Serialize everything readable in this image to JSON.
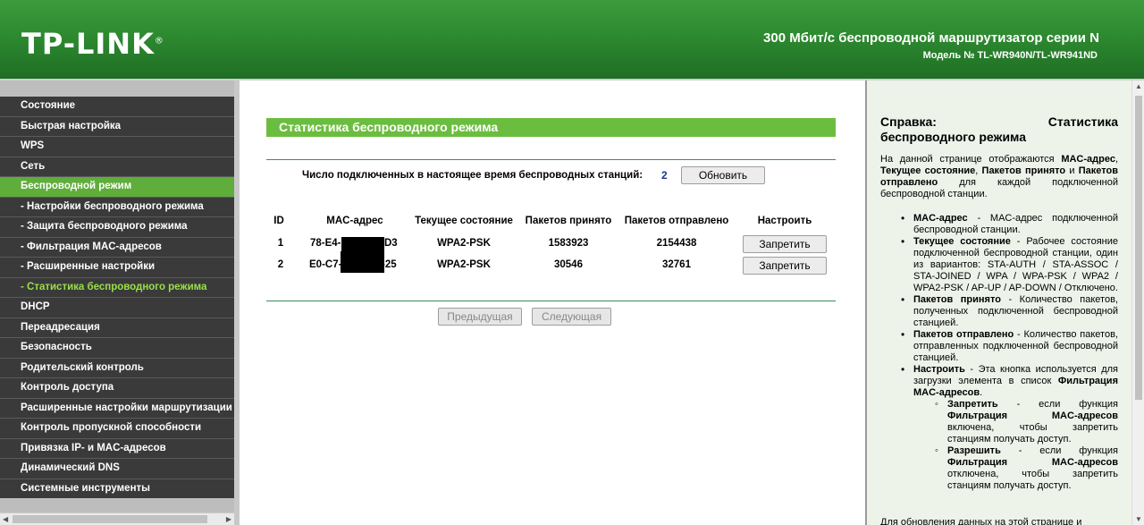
{
  "header": {
    "logo": "TP-LINK",
    "logo_mark": "®",
    "title": "300 Мбит/с беспроводной маршрутизатор серии N",
    "model": "Модель № TL-WR940N/TL-WR941ND"
  },
  "sidebar": {
    "items": [
      {
        "label": "Состояние"
      },
      {
        "label": "Быстрая настройка"
      },
      {
        "label": "WPS"
      },
      {
        "label": "Сеть"
      },
      {
        "label": "Беспроводной режим"
      },
      {
        "label": "- Настройки беспроводного режима"
      },
      {
        "label": "- Защита беспроводного режима"
      },
      {
        "label": "- Фильтрация MAC-адресов"
      },
      {
        "label": "- Расширенные настройки"
      },
      {
        "label": "- Статистика беспроводного режима"
      },
      {
        "label": "DHCP"
      },
      {
        "label": "Переадресация"
      },
      {
        "label": "Безопасность"
      },
      {
        "label": "Родительский контроль"
      },
      {
        "label": "Контроль доступа"
      },
      {
        "label": "Расширенные настройки маршрутизации"
      },
      {
        "label": "Контроль пропускной способности"
      },
      {
        "label": "Привязка IP- и MAC-адресов"
      },
      {
        "label": "Динамический DNS"
      },
      {
        "label": "Системные инструменты"
      }
    ]
  },
  "main": {
    "title": "Статистика беспроводного режима",
    "count_label": "Число подключенных в настоящее время беспроводных станций:",
    "count_value": "2",
    "refresh_button": "Обновить",
    "table": {
      "headers": [
        "ID",
        "MAC-адрес",
        "Текущее состояние",
        "Пакетов принято",
        "Пакетов отправлено",
        "Настроить"
      ],
      "rows": [
        {
          "id": "1",
          "mac_prefix": "78-E4-",
          "mac_suffix": "D3",
          "state": "WPA2-PSK",
          "received": "1583923",
          "sent": "2154438",
          "action": "Запретить"
        },
        {
          "id": "2",
          "mac_prefix": "E0-C7-",
          "mac_suffix": "-25",
          "state": "WPA2-PSK",
          "received": "30546",
          "sent": "32761",
          "action": "Запретить"
        }
      ]
    },
    "prev_button": "Предыдущая",
    "next_button": "Следующая"
  },
  "help": {
    "title_left": "Справка:",
    "title_right": "Статистика",
    "title_line2": "беспроводного режима",
    "intro_pre": "На данной странице отображаются ",
    "intro_b1": "MAC-адрес",
    "intro_sep1": ", ",
    "intro_b2": "Текущее состояние",
    "intro_sep2": ", ",
    "intro_b3": "Пакетов принято",
    "intro_sep3": " и ",
    "intro_b4": "Пакетов отправлено",
    "intro_post": " для каждой подключенной беспроводной станции.",
    "items": [
      {
        "term": "MAC-адрес",
        "text": " - MAC-адрес подключенной беспроводной станции."
      },
      {
        "term": "Текущее состояние",
        "text": " - Рабочее состояние подключенной беспроводной станции, один из вариантов: STA-AUTH / STA-ASSOC / STA-JOINED / WPA / WPA-PSK / WPA2 / WPA2-PSK / AP-UP / AP-DOWN / Отключено."
      },
      {
        "term": "Пакетов принято",
        "text": " - Количество пакетов, полученных подключенной беспроводной станцией."
      },
      {
        "term": "Пакетов отправлено",
        "text": " - Количество пакетов, отправленных подключенной беспроводной станцией."
      },
      {
        "term": "Настроить",
        "text": " - Эта кнопка используется для загрузки элемента в список ",
        "term2": "Фильтрация MAC-адресов",
        "text2": "."
      }
    ],
    "sub_items": [
      {
        "term": "Запретить",
        "text_a": " - если функция ",
        "term2": "Фильтрация MAC-адресов",
        "text_b": " включена, чтобы запретить станциям получать доступ."
      },
      {
        "term": "Разрешить",
        "text_a": " - если функция ",
        "term2": "Фильтрация MAC-адресов",
        "text_b": " отключена, чтобы запретить станциям получать доступ."
      }
    ],
    "footer": "Для обновления данных на этой странице и"
  },
  "colors": {
    "header_green": "#2d8a30",
    "menu_active": "#5fad3b",
    "submenu_active_text": "#9adf4a",
    "title_bar": "#6bbd3f",
    "help_bg": "#eef3ea"
  }
}
